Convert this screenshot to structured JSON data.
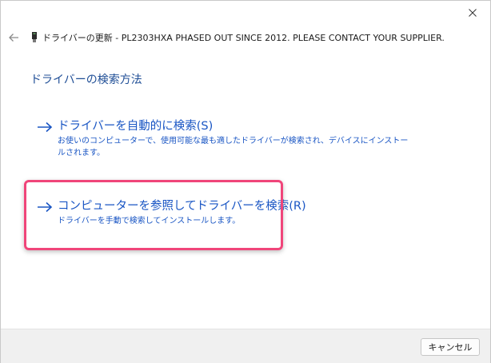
{
  "window": {
    "title": "ドライバーの更新 - PL2303HXA PHASED OUT SINCE 2012. PLEASE CONTACT YOUR SUPPLIER.",
    "icons": {
      "close": "close-icon",
      "back": "back-arrow-icon",
      "device": "usb-device-icon"
    }
  },
  "page": {
    "title": "ドライバーの検索方法"
  },
  "options": [
    {
      "label": "ドライバーを自動的に検索(S)",
      "description": "お使いのコンピューターで、使用可能な最も適したドライバーが検索され、デバイスにインストールされます。",
      "icon": "arrow-right-icon"
    },
    {
      "label": "コンピューターを参照してドライバーを検索(R)",
      "description": "ドライバーを手動で検索してインストールします。",
      "icon": "arrow-right-icon",
      "highlighted": true
    }
  ],
  "footer": {
    "cancel_label": "キャンセル"
  },
  "colors": {
    "accent_text": "#1a56c4",
    "title_text": "#1f4e96",
    "highlight_border": "#f0457a",
    "footer_bg": "#f0f0f0"
  }
}
